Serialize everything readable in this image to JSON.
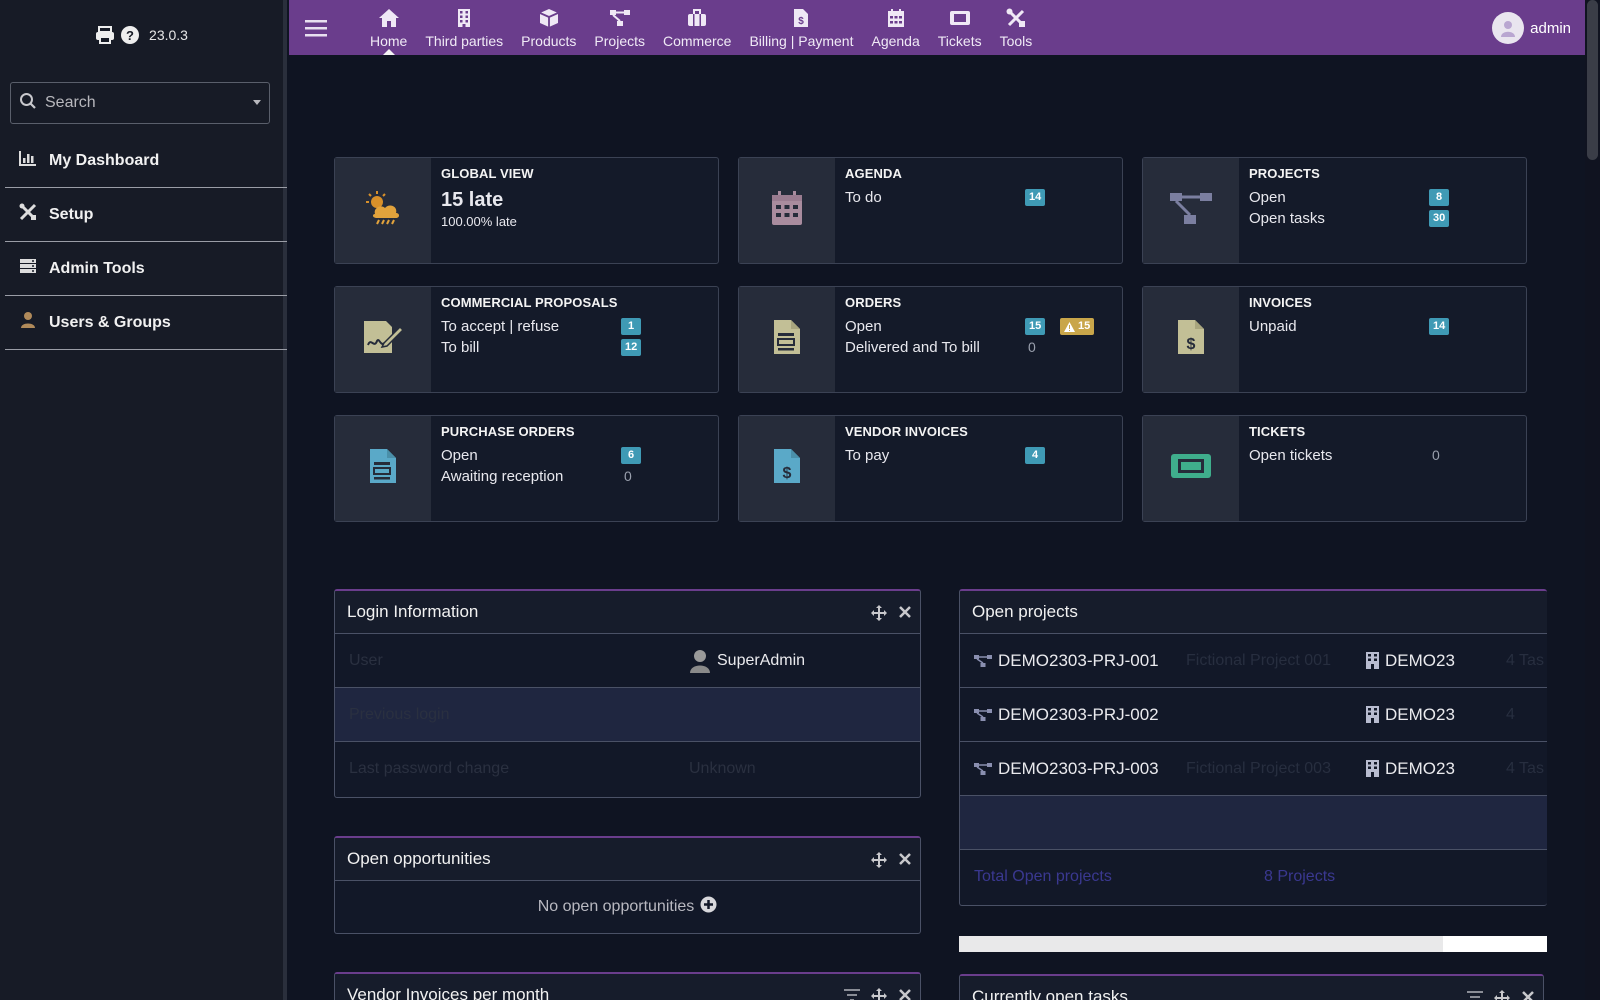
{
  "app": {
    "version": "23.0.3"
  },
  "sidebar": {
    "search_placeholder": "Search",
    "items": [
      {
        "label": "My Dashboard",
        "icon": "chart-icon"
      },
      {
        "label": "Setup",
        "icon": "tools-icon"
      },
      {
        "label": "Admin Tools",
        "icon": "server-icon"
      },
      {
        "label": "Users & Groups",
        "icon": "user-icon"
      }
    ]
  },
  "topnav": {
    "items": [
      {
        "label": "Home",
        "icon": "home-icon",
        "active": true
      },
      {
        "label": "Third parties",
        "icon": "building-icon"
      },
      {
        "label": "Products",
        "icon": "cube-icon"
      },
      {
        "label": "Projects",
        "icon": "sitemap-icon"
      },
      {
        "label": "Commerce",
        "icon": "briefcase-icon"
      },
      {
        "label": "Billing | Payment",
        "icon": "invoice-icon"
      },
      {
        "label": "Agenda",
        "icon": "calendar-icon"
      },
      {
        "label": "Tickets",
        "icon": "ticket-icon"
      },
      {
        "label": "Tools",
        "icon": "tools-icon"
      }
    ],
    "user": "admin"
  },
  "boxes": {
    "global": {
      "title": "GLOBAL VIEW",
      "big": "15 late",
      "sub": "100.00% late"
    },
    "agenda": {
      "title": "AGENDA",
      "line1": "To do",
      "badge1": "14"
    },
    "projects": {
      "title": "PROJECTS",
      "line1": "Open",
      "badge1": "8",
      "line2": "Open tasks",
      "badge2": "30"
    },
    "proposals": {
      "title": "COMMERCIAL PROPOSALS",
      "line1": "To accept | refuse",
      "badge1": "1",
      "line2": "To bill",
      "badge2": "12"
    },
    "orders": {
      "title": "ORDERS",
      "line1": "Open",
      "badge1": "15",
      "warn1": "15",
      "line2": "Delivered and To bill",
      "value2": "0"
    },
    "invoices": {
      "title": "INVOICES",
      "line1": "Unpaid",
      "badge1": "14"
    },
    "purchase": {
      "title": "PURCHASE ORDERS",
      "line1": "Open",
      "badge1": "6",
      "line2": "Awaiting reception",
      "value2": "0"
    },
    "vendor": {
      "title": "VENDOR INVOICES",
      "line1": "To pay",
      "badge1": "4"
    },
    "tickets": {
      "title": "TICKETS",
      "line1": "Open tickets",
      "value1": "0"
    }
  },
  "login_widget": {
    "title": "Login Information",
    "rows": [
      {
        "label": "User",
        "value": "SuperAdmin"
      },
      {
        "label": "Previous login",
        "value": ""
      },
      {
        "label": "Last password change",
        "value": "Unknown"
      }
    ]
  },
  "opportunities_widget": {
    "title": "Open opportunities",
    "empty": "No open opportunities"
  },
  "vendor_widget": {
    "title": "Vendor Invoices per month"
  },
  "projects_widget": {
    "title": "Open projects",
    "rows": [
      {
        "ref": "DEMO2303-PRJ-001",
        "label": "Fictional Project 001",
        "company": "DEMO23",
        "tasks": "4 Tas"
      },
      {
        "ref": "DEMO2303-PRJ-002",
        "label": "",
        "company": "DEMO23",
        "tasks": "4"
      },
      {
        "ref": "DEMO2303-PRJ-003",
        "label": "Fictional Project 003",
        "company": "DEMO23",
        "tasks": "4 Tas"
      }
    ],
    "total_label": "Total Open projects",
    "total_value": "8 Projects"
  },
  "tasks_widget": {
    "title": "Currently open tasks"
  },
  "colors": {
    "topbar": "#6a3d8c",
    "badge": "#3f9ab5",
    "warning": "#c9a64a",
    "sidebar": "#171b26",
    "background": "#0f1422"
  }
}
